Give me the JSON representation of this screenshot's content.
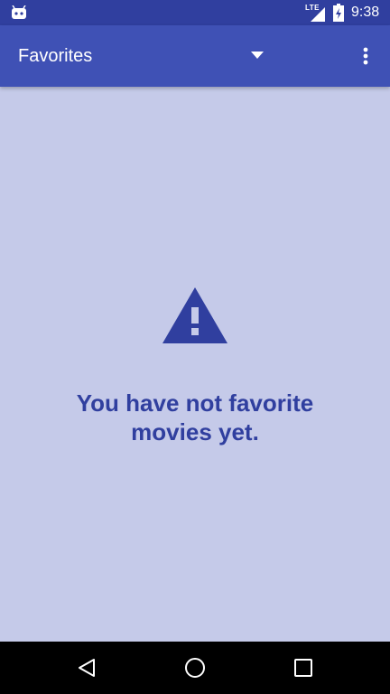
{
  "status_bar": {
    "network": "LTE",
    "time": "9:38",
    "icons": [
      "android-icon",
      "signal-icon",
      "battery-icon"
    ]
  },
  "toolbar": {
    "title": "Favorites",
    "icons": [
      "dropdown-icon",
      "more-vert-icon"
    ]
  },
  "empty_state": {
    "icon": "warning-icon",
    "message": "You have not favorite movies yet."
  },
  "nav_bar": {
    "icons": [
      "back-icon",
      "home-icon",
      "recents-icon"
    ]
  },
  "colors": {
    "status_bar": "#303f9f",
    "toolbar": "#3f51b5",
    "background": "#c5cae9",
    "accent_text": "#303f9f",
    "nav_bar": "#000000"
  }
}
